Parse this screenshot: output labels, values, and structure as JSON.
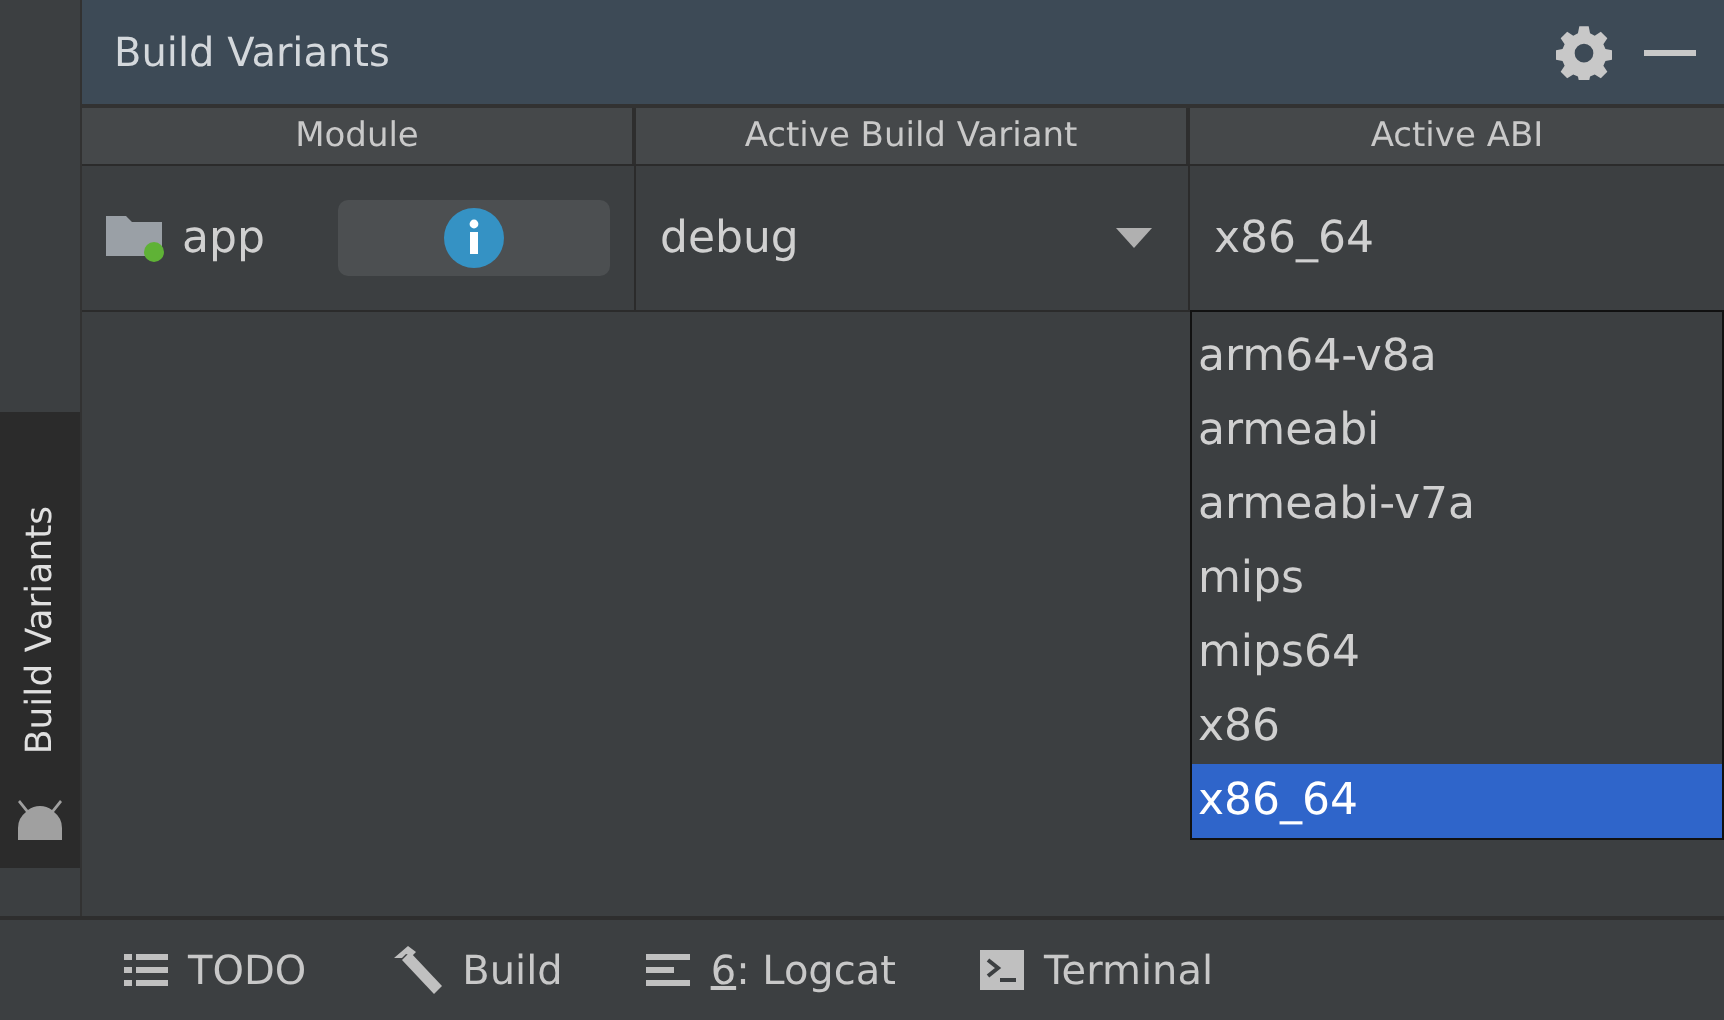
{
  "side_tab": {
    "label": "Build Variants",
    "selected": true
  },
  "panel": {
    "title": "Build Variants"
  },
  "table": {
    "columns": [
      "Module",
      "Active Build Variant",
      "Active ABI"
    ],
    "rows": [
      {
        "module": "app",
        "variant": "debug",
        "abi": "x86_64"
      }
    ]
  },
  "abi_dropdown": {
    "options": [
      {
        "label": "arm64-v8a",
        "selected": false
      },
      {
        "label": "armeabi",
        "selected": false
      },
      {
        "label": "armeabi-v7a",
        "selected": false
      },
      {
        "label": "mips",
        "selected": false
      },
      {
        "label": "mips64",
        "selected": false
      },
      {
        "label": "x86",
        "selected": false
      },
      {
        "label": "x86_64",
        "selected": true
      }
    ]
  },
  "bottom_tabs": [
    {
      "kind": "todo",
      "label": "TODO"
    },
    {
      "kind": "build",
      "label": "Build"
    },
    {
      "kind": "logcat",
      "mnemonic": "6",
      "label": ": Logcat"
    },
    {
      "kind": "terminal",
      "label": "Terminal"
    }
  ]
}
